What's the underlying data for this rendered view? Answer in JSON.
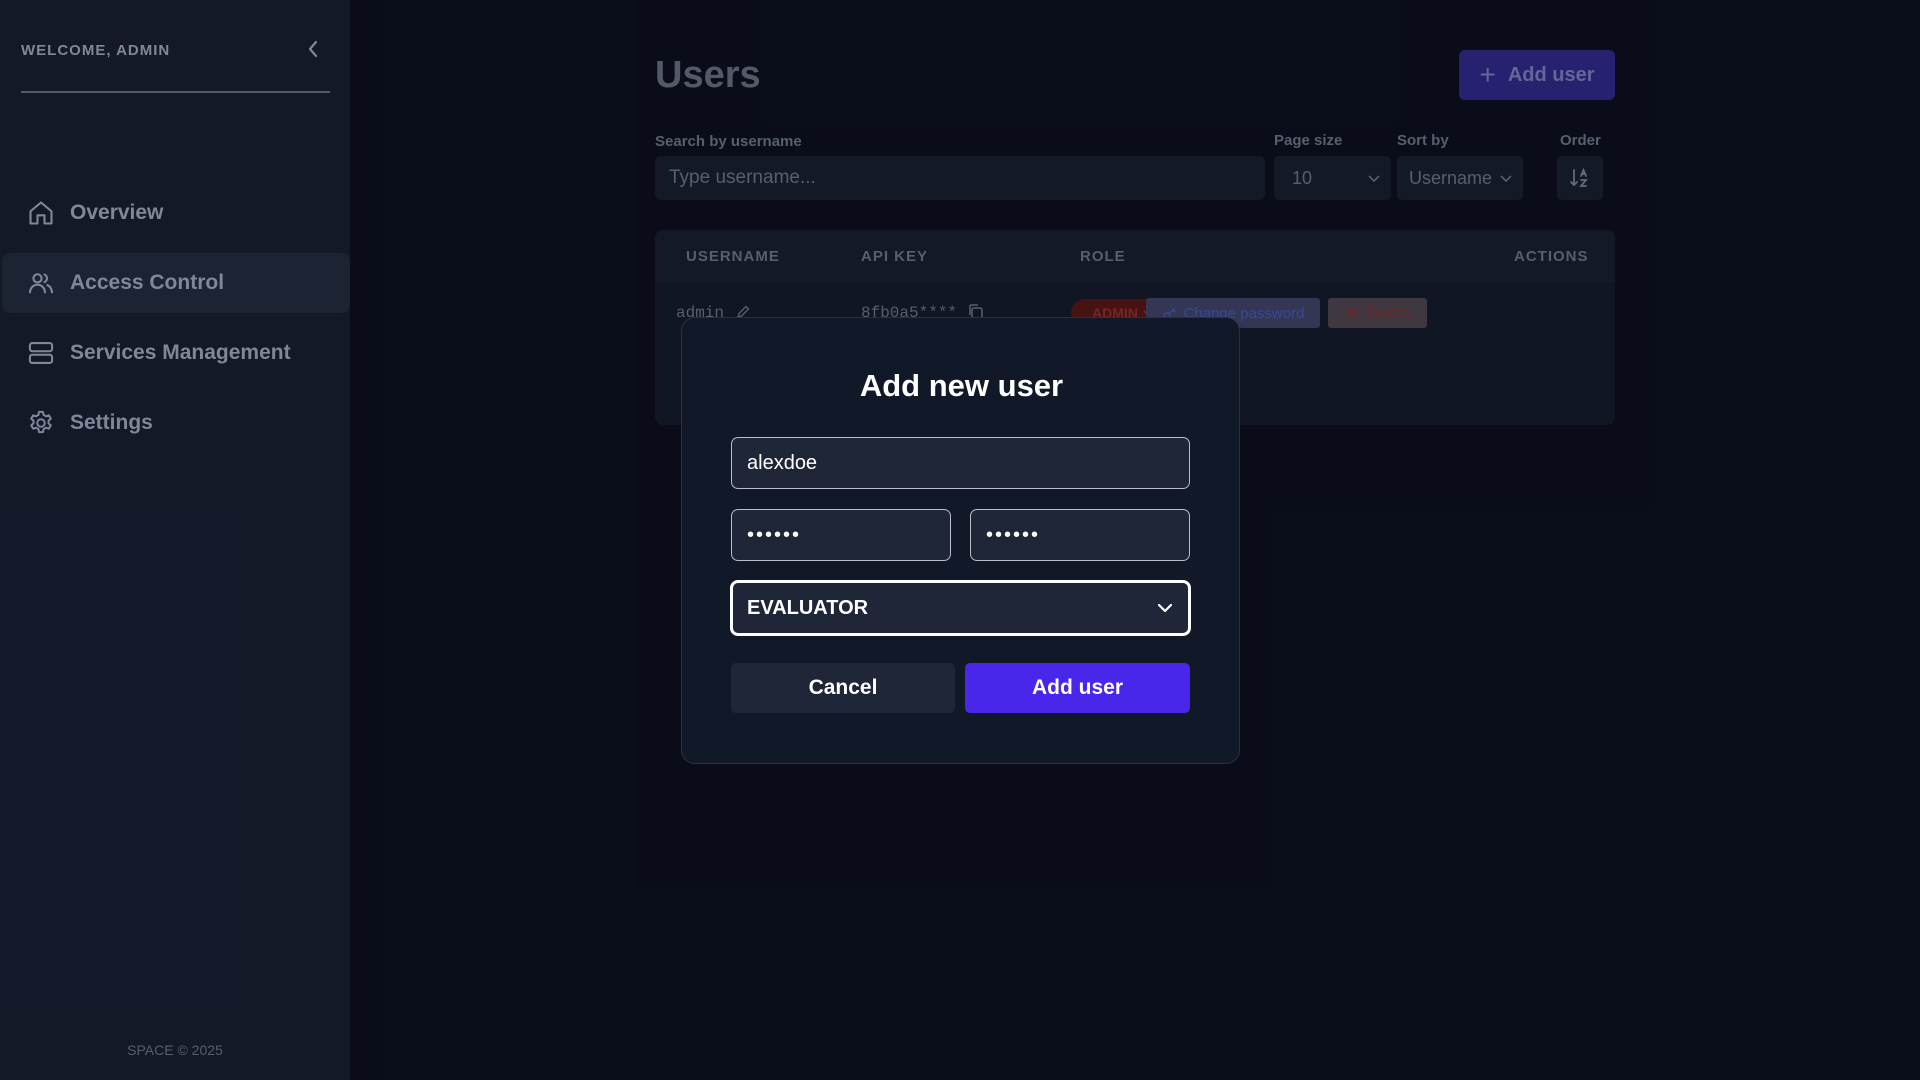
{
  "sidebar": {
    "welcome": "WELCOME, ADMIN",
    "items": [
      {
        "label": "Overview",
        "icon": "home-icon"
      },
      {
        "label": "Access Control",
        "icon": "users-icon"
      },
      {
        "label": "Services Management",
        "icon": "server-icon"
      },
      {
        "label": "Settings",
        "icon": "gear-icon"
      }
    ],
    "active_item": "Access Control",
    "footer": "SPACE © 2025"
  },
  "header": {
    "title": "Users",
    "add_button": "Add user"
  },
  "filters": {
    "search_label": "Search by username",
    "search_placeholder": "Type username...",
    "page_size_label": "Page size",
    "page_size_value": "10",
    "sort_by_label": "Sort by",
    "sort_by_value": "Username",
    "order_label": "Order"
  },
  "table": {
    "columns": [
      "USERNAME",
      "API KEY",
      "ROLE",
      "ACTIONS"
    ],
    "rows": [
      {
        "username": "admin",
        "api_key": "8fb0a5****",
        "role": "ADMIN",
        "actions": [
          "Change password",
          "Delete"
        ]
      }
    ]
  },
  "modal": {
    "title": "Add new user",
    "username_value": "alexdoe",
    "password_value": "••••••",
    "confirm_password_value": "••••••",
    "role_value": "EVALUATOR",
    "cancel_label": "Cancel",
    "submit_label": "Add user"
  },
  "colors": {
    "accent": "#4827ea",
    "background": "#0b0f1c",
    "sidebar": "#161c2c",
    "modal": "#111827",
    "danger": "#7d2b2b"
  }
}
